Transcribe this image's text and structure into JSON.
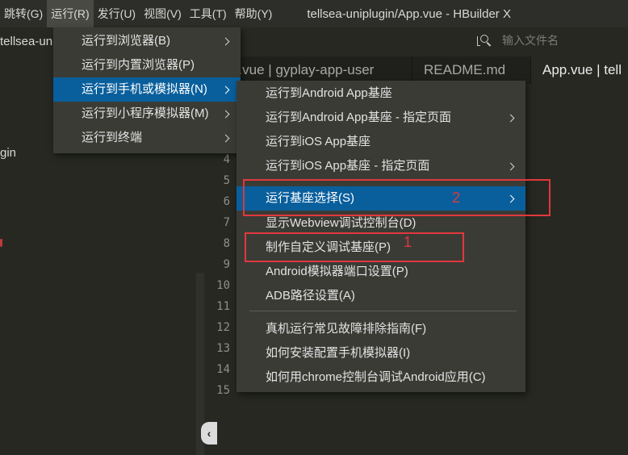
{
  "menubar": {
    "items": [
      "跳转(G)",
      "运行(R)",
      "发行(U)",
      "视图(V)",
      "工具(T)",
      "帮助(Y)"
    ],
    "window_title": "tellsea-uniplugin/App.vue - HBuilder X"
  },
  "project_label": "tellsea-uni",
  "search": {
    "placeholder": "输入文件名"
  },
  "sidebar": {
    "visible_item": "gin"
  },
  "tabs": [
    "p.vue | gyplay-app-user",
    "README.md",
    "App.vue | tell"
  ],
  "line_numbers": [
    "4",
    "5",
    "6",
    "7",
    "8",
    "9",
    "10",
    "11",
    "12",
    "13",
    "14",
    "15"
  ],
  "run_menu": {
    "items": [
      {
        "label": "运行到浏览器(B)",
        "submenu": true
      },
      {
        "label": "运行到内置浏览器(P)",
        "submenu": false
      },
      {
        "label": "运行到手机或模拟器(N)",
        "submenu": true,
        "highlighted": true
      },
      {
        "label": "运行到小程序模拟器(M)",
        "submenu": true
      },
      {
        "label": "运行到终端",
        "submenu": true
      }
    ]
  },
  "device_menu": {
    "items": [
      {
        "label": "运行到Android App基座",
        "submenu": false
      },
      {
        "label": "运行到Android App基座 - 指定页面",
        "submenu": true
      },
      {
        "label": "运行到iOS App基座",
        "submenu": false
      },
      {
        "label": "运行到iOS App基座 - 指定页面",
        "submenu": true
      },
      {
        "label": "运行基座选择(S)",
        "submenu": true,
        "highlighted": true
      },
      {
        "label": "显示Webview调试控制台(D)",
        "submenu": false
      },
      {
        "label": "制作自定义调试基座(P)",
        "submenu": false
      },
      {
        "label": "Android模拟器端口设置(P)",
        "submenu": false
      },
      {
        "label": "ADB路径设置(A)",
        "submenu": false
      },
      {
        "label": "真机运行常见故障排除指南(F)",
        "submenu": false
      },
      {
        "label": "如何安装配置手机模拟器(I)",
        "submenu": false
      },
      {
        "label": "如何用chrome控制台调试Android应用(C)",
        "submenu": false
      }
    ]
  },
  "annotations": {
    "label_1": "1",
    "label_2": "2",
    "color": "#e0383c"
  },
  "colors": {
    "highlight": "#095f9c",
    "menu_bg": "#3b3b36",
    "editor_bg": "#272822"
  },
  "icons": {
    "search": "search-file-icon",
    "collapse": "chevron-left-icon"
  }
}
